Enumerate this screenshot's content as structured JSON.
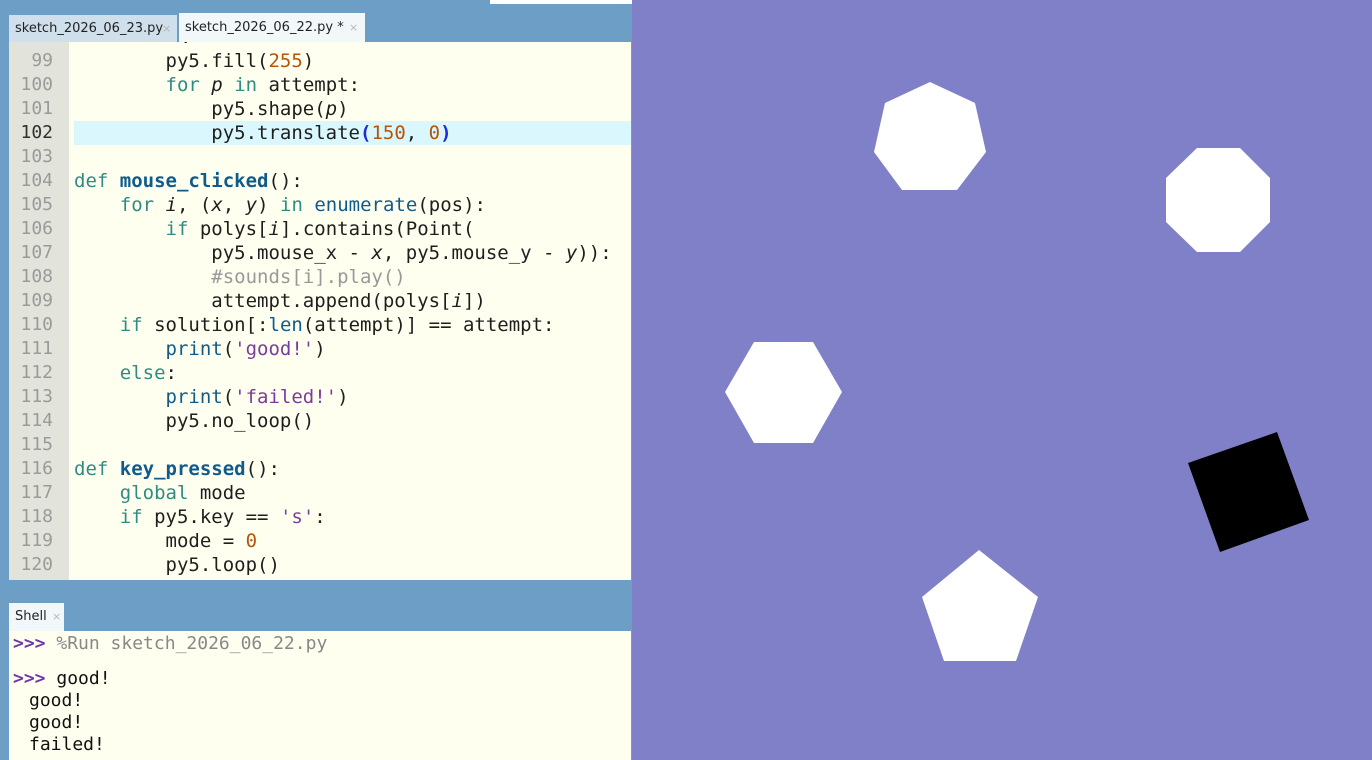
{
  "editor": {
    "tabs": [
      {
        "label": "sketch_2026_06_23.py",
        "active": false
      },
      {
        "label": "sketch_2026_06_22.py *",
        "active": true
      }
    ],
    "close_glyph": "×",
    "current_line": "102",
    "line_numbers": [
      "99",
      "100",
      "101",
      "102",
      "103",
      "104",
      "105",
      "106",
      "107",
      "108",
      "109",
      "110",
      "111",
      "112",
      "113",
      "114",
      "115",
      "116",
      "117",
      "118",
      "119",
      "120"
    ],
    "partial_top": "·",
    "lines": [
      "        py5.fill(255)",
      "        for p in attempt:",
      "            py5.shape(p)",
      "            py5.translate(150, 0)",
      "",
      "def mouse_clicked():",
      "    for i, (x, y) in enumerate(pos):",
      "        if polys[i].contains(Point(",
      "            py5.mouse_x - x, py5.mouse_y - y)):",
      "            #sounds[i].play()",
      "            attempt.append(polys[i])",
      "    if solution[:len(attempt)] == attempt:",
      "        print('good!')",
      "    else:",
      "        print('failed!')",
      "        py5.no_loop()",
      "",
      "def key_pressed():",
      "    global mode",
      "    if py5.key == 's':",
      "        mode = 0",
      "        py5.loop()"
    ]
  },
  "shell": {
    "tab_label": "Shell",
    "prompt": ">>>",
    "run_command": "%Run sketch_2026_06_22.py",
    "output": [
      "good!",
      "good!",
      "good!",
      "failed!"
    ]
  },
  "sketch": {
    "background": "#8080c8",
    "shapes": [
      {
        "name": "heptagon",
        "color": "#ffffff"
      },
      {
        "name": "octagon",
        "color": "#ffffff"
      },
      {
        "name": "hexagon",
        "color": "#ffffff"
      },
      {
        "name": "square",
        "color": "#000000"
      },
      {
        "name": "pentagon",
        "color": "#ffffff"
      }
    ]
  }
}
